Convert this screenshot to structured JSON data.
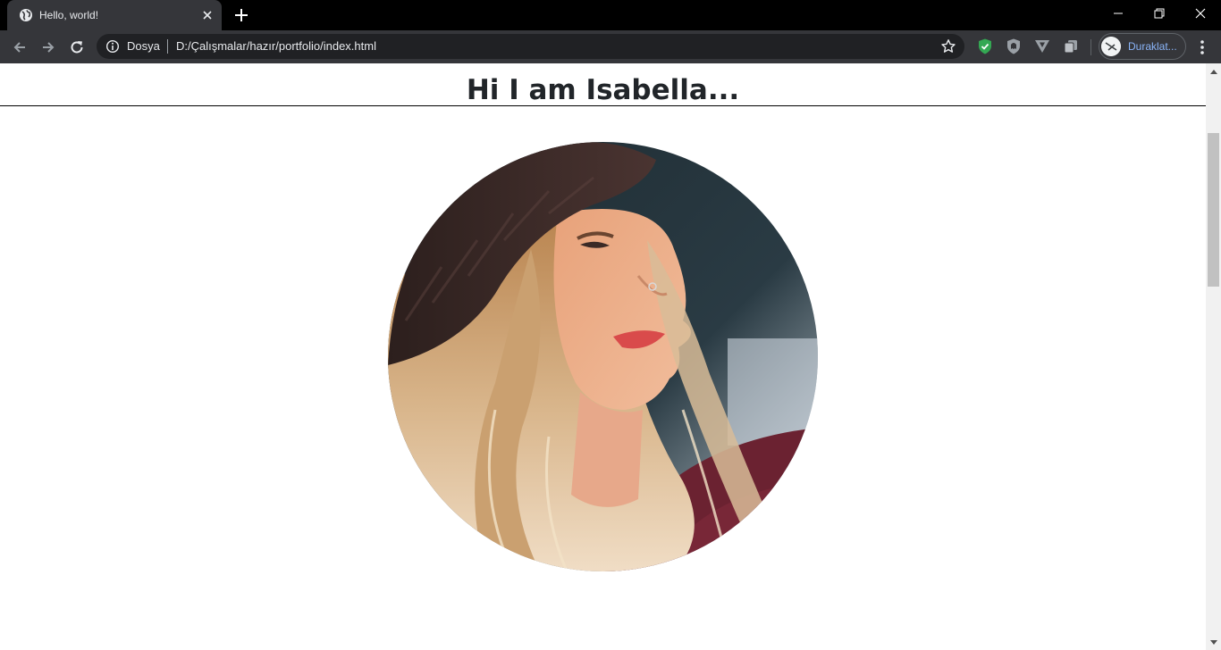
{
  "tab": {
    "title": "Hello, world!"
  },
  "omnibox": {
    "chip_label": "Dosya",
    "url": "D:/Çalışmalar/hazır/portfolio/index.html"
  },
  "profile": {
    "label": "Duraklat..."
  },
  "page": {
    "heading": "Hi I am Isabella..."
  },
  "colors": {
    "chrome_dark": "#35363a",
    "omnibox_bg": "#202124",
    "profile_text": "#8ab4f8",
    "heading_text": "#212529"
  },
  "icons": [
    "globe-icon",
    "close-icon",
    "plus-icon",
    "minimize-icon",
    "restore-icon",
    "back-arrow-icon",
    "forward-arrow-icon",
    "reload-icon",
    "info-icon",
    "star-icon",
    "shield-extension-icon",
    "ghost-shield-extension-icon",
    "v-extension-icon",
    "copy-extension-icon",
    "avatar-icon",
    "kebab-menu-icon",
    "scroll-up-arrow-icon",
    "scroll-down-arrow-icon"
  ]
}
